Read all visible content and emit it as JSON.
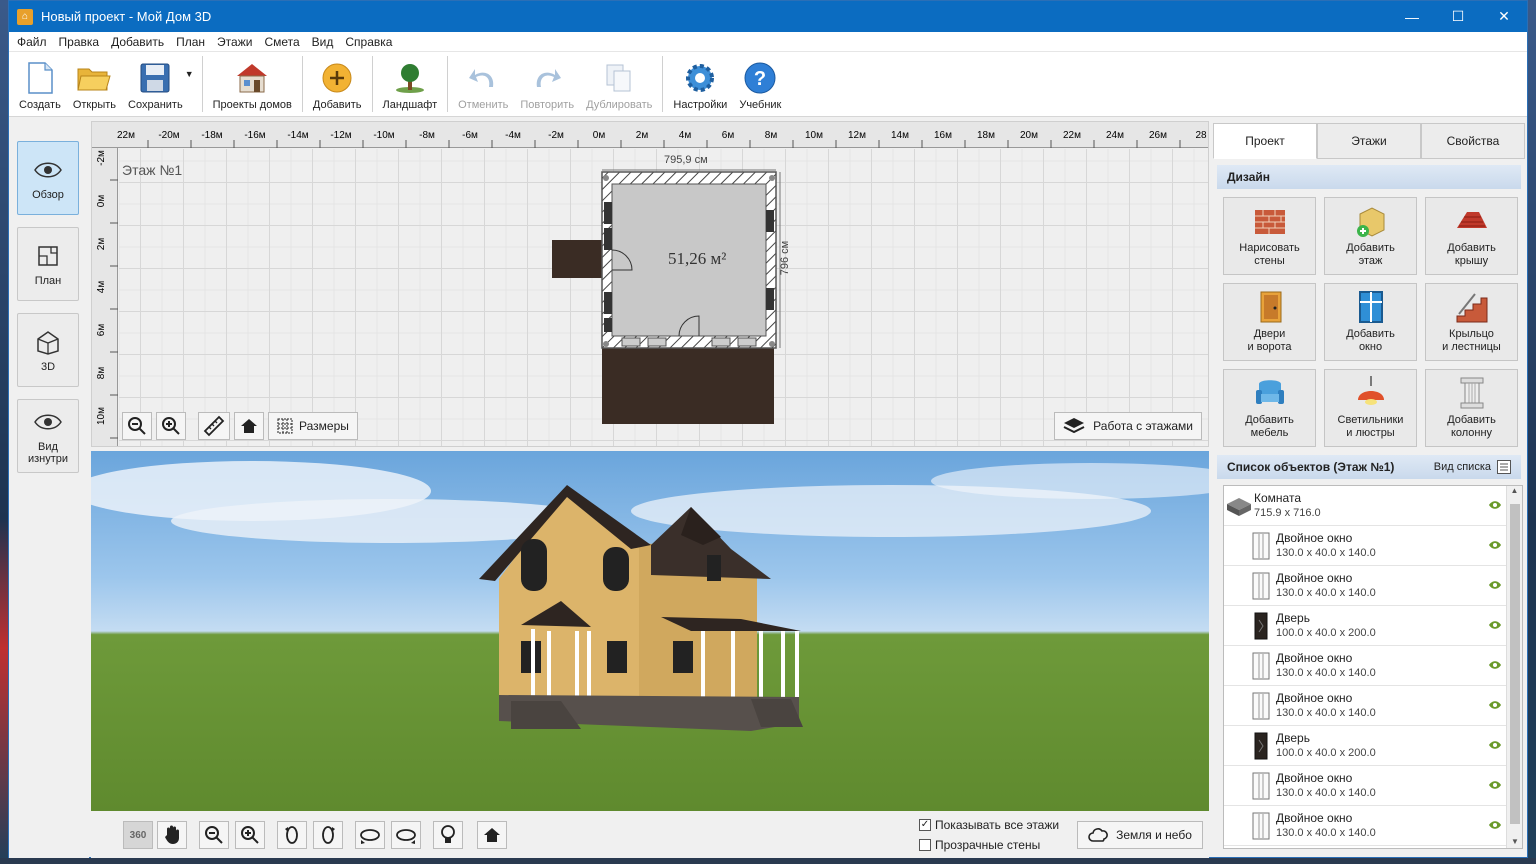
{
  "window": {
    "title": "Новый проект - Мой Дом 3D",
    "minimize": "—",
    "maximize": "☐",
    "close": "✕"
  },
  "menu": [
    "Файл",
    "Правка",
    "Добавить",
    "План",
    "Этажи",
    "Смета",
    "Вид",
    "Справка"
  ],
  "toolbar": {
    "create": "Создать",
    "open": "Открыть",
    "save": "Сохранить",
    "projects": "Проекты домов",
    "add": "Добавить",
    "landscape": "Ландшафт",
    "undo": "Отменить",
    "redo": "Повторить",
    "duplicate": "Дублировать",
    "settings": "Настройки",
    "tutorial": "Учебник"
  },
  "left_nav": {
    "overview": "Обзор",
    "plan": "План",
    "view3d": "3D",
    "inside": "Вид изнутри"
  },
  "plan": {
    "floor_label": "Этаж №1",
    "ruler_top": [
      "22м",
      "-20м",
      "-18м",
      "-16м",
      "-14м",
      "-12м",
      "-10м",
      "-8м",
      "-6м",
      "-4м",
      "-2м",
      "0м",
      "2м",
      "4м",
      "6м",
      "8м",
      "10м",
      "12м",
      "14м",
      "16м",
      "18м",
      "20м",
      "22м",
      "24м",
      "26м",
      "28"
    ],
    "ruler_left": [
      "-2м",
      "0м",
      "2м",
      "4м",
      "6м",
      "8м",
      "10м"
    ],
    "width_dim": "795,9 см",
    "height_dim": "796 см",
    "area": "51,26 м²",
    "dimensions_btn": "Размеры",
    "floors_btn": "Работа с этажами"
  },
  "bottom": {
    "rotate360": "360",
    "show_all_floors": "Показывать все этажи",
    "transparent_walls": "Прозрачные стены",
    "earth_sky": "Земля и небо"
  },
  "right": {
    "tabs": [
      "Проект",
      "Этажи",
      "Свойства"
    ],
    "design_title": "Дизайн",
    "design_buttons": [
      {
        "l1": "Нарисовать",
        "l2": "стены"
      },
      {
        "l1": "Добавить",
        "l2": "этаж"
      },
      {
        "l1": "Добавить",
        "l2": "крышу"
      },
      {
        "l1": "Двери",
        "l2": "и ворота"
      },
      {
        "l1": "Добавить",
        "l2": "окно"
      },
      {
        "l1": "Крыльцо",
        "l2": "и лестницы"
      },
      {
        "l1": "Добавить",
        "l2": "мебель"
      },
      {
        "l1": "Светильники",
        "l2": "и люстры"
      },
      {
        "l1": "Добавить",
        "l2": "колонну"
      }
    ],
    "list_title": "Список объектов (Этаж №1)",
    "list_view": "Вид списка",
    "objects": [
      {
        "name": "Комната",
        "size": "715.9 x 716.0",
        "kind": "room"
      },
      {
        "name": "Двойное окно",
        "size": "130.0 x 40.0 x 140.0",
        "kind": "window"
      },
      {
        "name": "Двойное окно",
        "size": "130.0 x 40.0 x 140.0",
        "kind": "window"
      },
      {
        "name": "Дверь",
        "size": "100.0 x 40.0 x 200.0",
        "kind": "door"
      },
      {
        "name": "Двойное окно",
        "size": "130.0 x 40.0 x 140.0",
        "kind": "window"
      },
      {
        "name": "Двойное окно",
        "size": "130.0 x 40.0 x 140.0",
        "kind": "window"
      },
      {
        "name": "Дверь",
        "size": "100.0 x 40.0 x 200.0",
        "kind": "door"
      },
      {
        "name": "Двойное окно",
        "size": "130.0 x 40.0 x 140.0",
        "kind": "window"
      },
      {
        "name": "Двойное окно",
        "size": "130.0 x 40.0 x 140.0",
        "kind": "window"
      }
    ]
  }
}
